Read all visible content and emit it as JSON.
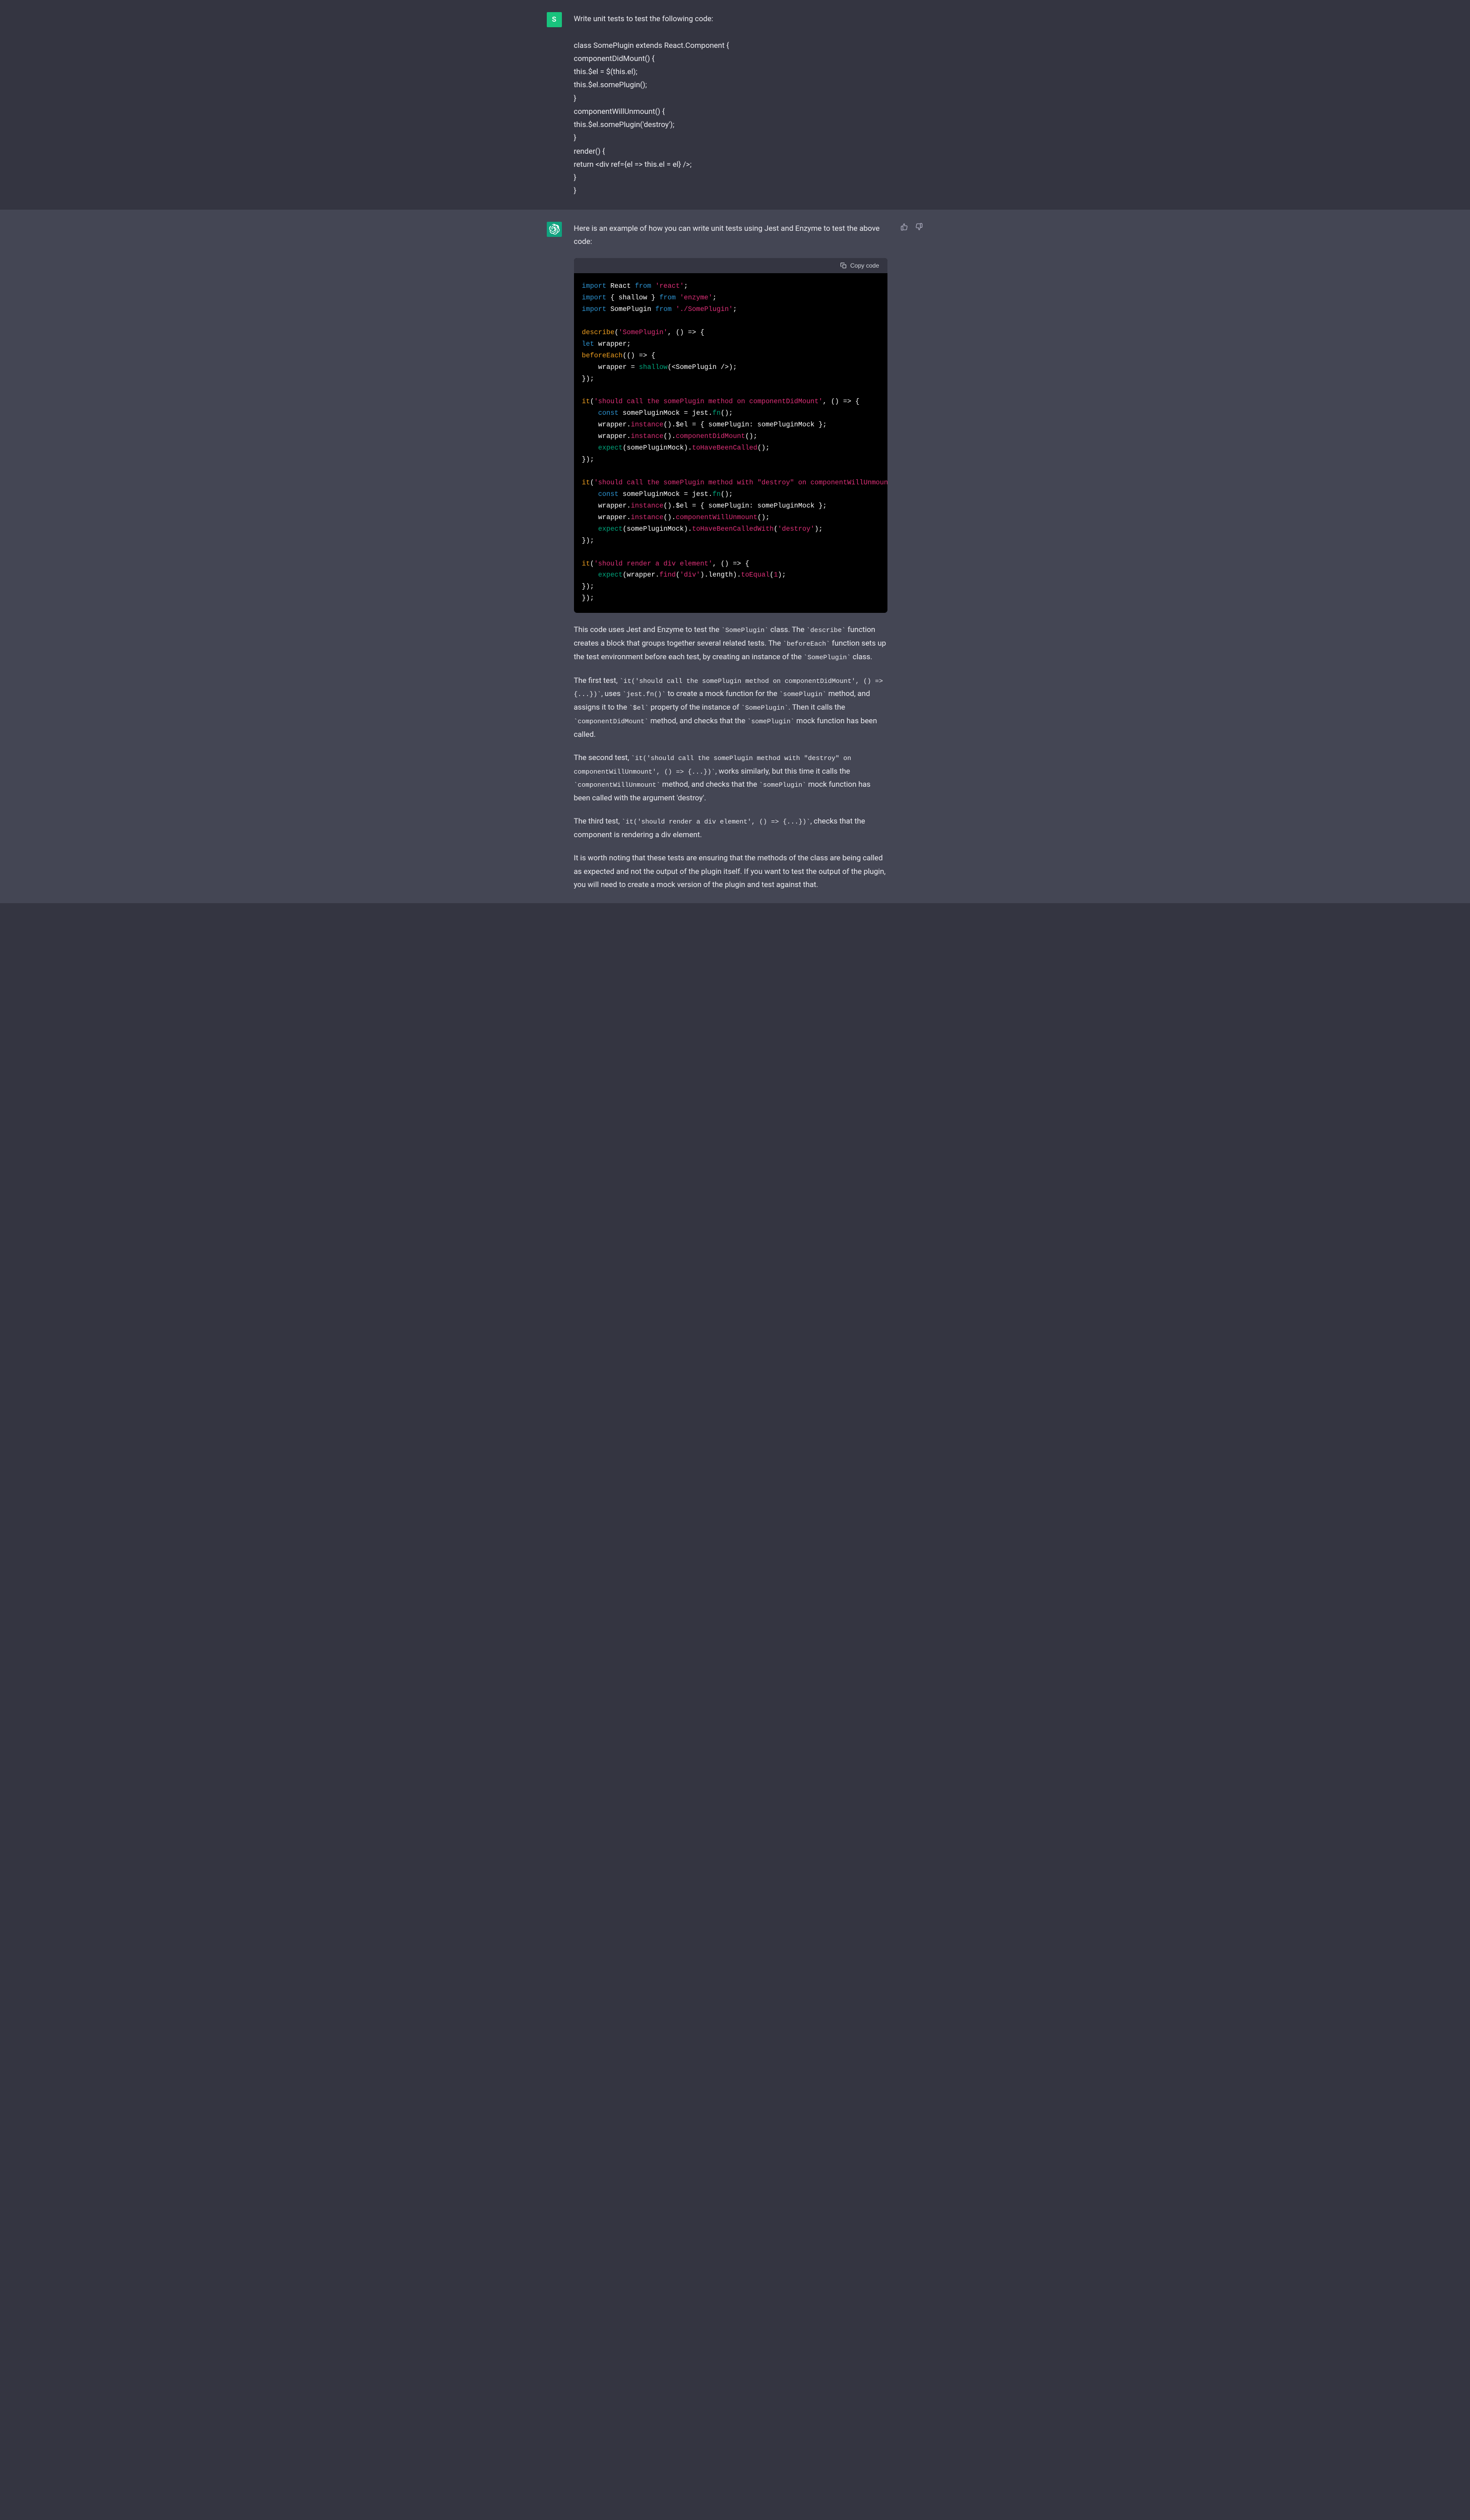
{
  "user": {
    "initial": "S",
    "prompt_intro": "Write unit tests to test the following code:",
    "code_lines": [
      "class SomePlugin extends React.Component {",
      "componentDidMount() {",
      "this.$el = $(this.el);",
      "this.$el.somePlugin();",
      "}",
      "componentWillUnmount() {",
      "this.$el.somePlugin('destroy');",
      "}",
      "render() {",
      "return <div ref={el => this.el = el} />;",
      "}",
      "}"
    ]
  },
  "assistant": {
    "intro": "Here is an example of how you can write unit tests using Jest and Enzyme to test the above code:",
    "copy_label": "Copy code",
    "code": {
      "l1": {
        "kw": "import",
        "w1": " React ",
        "kw2": "from",
        "s1": " 'react'",
        "end": ";"
      },
      "l2": {
        "kw": "import",
        "w1": " { shallow } ",
        "kw2": "from",
        "s1": " 'enzyme'",
        "end": ";"
      },
      "l3": {
        "kw": "import",
        "w1": " SomePlugin ",
        "kw2": "from",
        "s1": " './SomePlugin'",
        "end": ";"
      },
      "l4": {
        "fn": "describe",
        "p1": "(",
        "s1": "'SomePlugin'",
        "p2": ", () => {"
      },
      "l5": {
        "kw": "let",
        "w1": " wrapper;"
      },
      "l6": {
        "fn": "beforeEach",
        "p1": "(() => {"
      },
      "l7": {
        "w1": "    wrapper = ",
        "call": "shallow",
        "p1": "(<SomePlugin />);"
      },
      "l8": {
        "p1": "});"
      },
      "l9": {
        "fn": "it",
        "p1": "(",
        "s1": "'should call the somePlugin method on componentDidMount'",
        "p2": ", () => {"
      },
      "l10": {
        "kw": "    const",
        "w1": " somePluginMock = jest.",
        "call": "fn",
        "p1": "();"
      },
      "l11": {
        "w1": "    wrapper.",
        "m1": "instance",
        "w2": "().$el = { somePlugin: somePluginMock };"
      },
      "l12": {
        "w1": "    wrapper.",
        "m1": "instance",
        "w2": "().",
        "m2": "componentDidMount",
        "p1": "();"
      },
      "l13": {
        "call": "    expect",
        "w1": "(somePluginMock).",
        "m1": "toHaveBeenCalled",
        "p1": "();"
      },
      "l14": {
        "p1": "});"
      },
      "l15": {
        "fn": "it",
        "p1": "(",
        "s1": "'should call the somePlugin method with \"destroy\" on componentWillUnmount'",
        "p2": ", () => {"
      },
      "l16": {
        "kw": "    const",
        "w1": " somePluginMock = jest.",
        "call": "fn",
        "p1": "();"
      },
      "l17": {
        "w1": "    wrapper.",
        "m1": "instance",
        "w2": "().$el = { somePlugin: somePluginMock };"
      },
      "l18": {
        "w1": "    wrapper.",
        "m1": "instance",
        "w2": "().",
        "m2": "componentWillUnmount",
        "p1": "();"
      },
      "l19": {
        "call": "    expect",
        "w1": "(somePluginMock).",
        "m1": "toHaveBeenCalledWith",
        "p1": "(",
        "s1": "'destroy'",
        "p2": ");"
      },
      "l20": {
        "p1": "});"
      },
      "l21": {
        "fn": "it",
        "p1": "(",
        "s1": "'should render a div element'",
        "p2": ", () => {"
      },
      "l22": {
        "call": "    expect",
        "w1": "(wrapper.",
        "m1": "find",
        "p1": "(",
        "s1": "'div'",
        "w2": ").length).",
        "m2": "toEqual",
        "p2": "(",
        "n1": "1",
        "p3": ");"
      },
      "l23": {
        "p1": "});"
      },
      "l24": {
        "p1": "});"
      }
    },
    "p1": {
      "t1": "This code uses Jest and Enzyme to test the ",
      "c1": "`SomePlugin`",
      "t2": " class. The ",
      "c2": "`describe`",
      "t3": " function creates a block that groups together several related tests. The ",
      "c3": "`beforeEach`",
      "t4": " function sets up the test environment before each test, by creating an instance of the ",
      "c4": "`SomePlugin`",
      "t5": " class."
    },
    "p2": {
      "t1": "The first test, ",
      "c1": "`it('should call the somePlugin method on componentDidMount', () => {...})`",
      "t2": ", uses ",
      "c2": "`jest.fn()`",
      "t3": " to create a mock function for the ",
      "c3": "`somePlugin`",
      "t4": " method, and assigns it to the ",
      "c4": "`$el`",
      "t5": " property of the instance of ",
      "c5": "`SomePlugin`",
      "t6": ". Then it calls the ",
      "c6": "`componentDidMount`",
      "t7": " method, and checks that the ",
      "c7": "`somePlugin`",
      "t8": " mock function has been called."
    },
    "p3": {
      "t1": "The second test, ",
      "c1": "`it('should call the somePlugin method with \"destroy\" on componentWillUnmount', () => {...})`",
      "t2": ", works similarly, but this time it calls the ",
      "c2": "`componentWillUnmount`",
      "t3": " method, and checks that the ",
      "c3": "`somePlugin`",
      "t4": " mock function has been called with the argument 'destroy'."
    },
    "p4": {
      "t1": "The third test, ",
      "c1": "`it('should render a div element', () => {...})`",
      "t2": ", checks that the component is rendering a div element."
    },
    "p5": "It is worth noting that these tests are ensuring that the methods of the class are being called as expected and not the output of the plugin itself. If you want to test the output of the plugin, you will need to create a mock version of the plugin and test against that."
  }
}
